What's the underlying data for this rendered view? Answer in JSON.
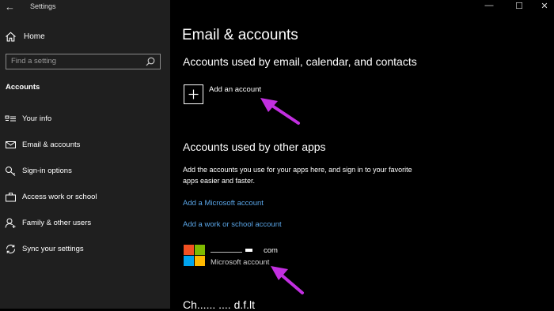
{
  "window": {
    "title": "Settings",
    "back_icon": "arrow-left-icon",
    "controls": {
      "minimize": "—",
      "maximize": "☐",
      "close": "✕"
    }
  },
  "sidebar": {
    "home_label": "Home",
    "search_placeholder": "Find a setting",
    "section_label": "Accounts",
    "items": [
      {
        "label": "Your info",
        "icon": "contact-card-icon"
      },
      {
        "label": "Email & accounts",
        "icon": "mail-icon"
      },
      {
        "label": "Sign-in options",
        "icon": "key-icon"
      },
      {
        "label": "Access work or school",
        "icon": "briefcase-icon"
      },
      {
        "label": "Family & other users",
        "icon": "person-add-icon"
      },
      {
        "label": "Sync your settings",
        "icon": "sync-icon"
      }
    ]
  },
  "main": {
    "title": "Email & accounts",
    "section1_heading": "Accounts used by email, calendar, and contacts",
    "add_account_label": "Add an account",
    "section2_heading": "Accounts used by other apps",
    "section2_description": "Add the accounts you use for your apps here, and sign in to your favorite apps easier and faster.",
    "add_microsoft_link": "Add a Microsoft account",
    "add_work_link": "Add a work or school account",
    "account": {
      "email_suffix": "com",
      "type": "Microsoft account"
    },
    "cutoff_heading": "Ch...... .... d.f.lt"
  },
  "colors": {
    "sidebar_bg": "#1f1f1f",
    "main_bg": "#000000",
    "link": "#5aa6e8",
    "annotation_arrow": "#c22fe0",
    "ms_red": "#f25022",
    "ms_green": "#7fba00",
    "ms_blue": "#00a4ef",
    "ms_yellow": "#ffb900"
  }
}
